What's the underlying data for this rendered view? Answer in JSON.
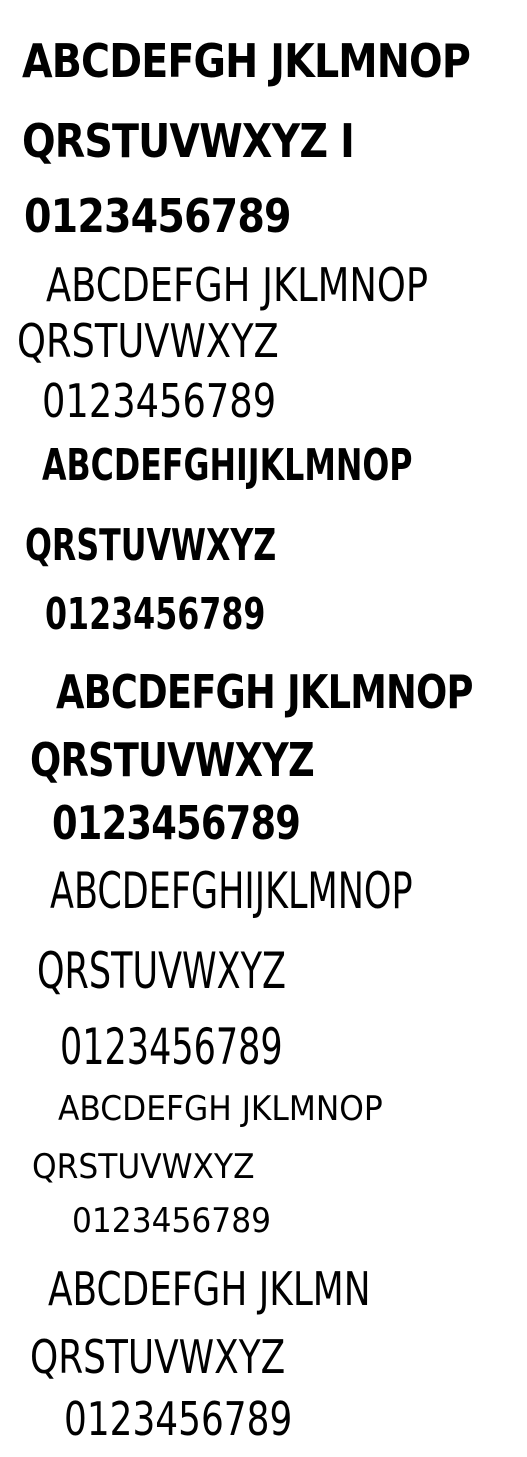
{
  "specimen": {
    "sets": [
      {
        "letters_1": "ABCDEFGH JKLMNOP",
        "letters_2": "QRSTUVWXYZ I",
        "digits": "0123456789"
      },
      {
        "letters_1": "ABCDEFGH JKLMNOP",
        "letters_2": "QRSTUVWXYZ",
        "digits": "0123456789"
      },
      {
        "letters_1": "ABCDEFGHIJKLMNOP",
        "letters_2": "QRSTUVWXYZ",
        "digits": "0123456789"
      },
      {
        "letters_1": "ABCDEFGH JKLMNOP",
        "letters_2": "QRSTUVWXYZ",
        "digits": "0123456789"
      },
      {
        "letters_1": "ABCDEFGHIJKLMNOP",
        "letters_2": "QRSTUVWXYZ",
        "digits": "0123456789"
      },
      {
        "letters_1": "ABCDEFGH JKLMNOP",
        "letters_2": "QRSTUVWXYZ",
        "digits": "0123456789"
      },
      {
        "letters_1": "ABCDEFGH JKLMN",
        "letters_2": "QRSTUVWXYZ",
        "digits": "0123456789"
      }
    ]
  },
  "colors": {
    "background": "#ffffff",
    "text": "#000000"
  }
}
